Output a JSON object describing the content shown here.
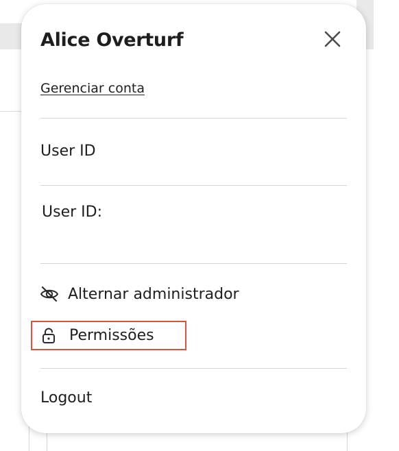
{
  "popup": {
    "user_name": "Alice Overturf",
    "close_icon": "close-icon",
    "manage_account_label": "Gerenciar conta",
    "user_id_label": "User ID",
    "user_id_field_label": "User ID:",
    "menu": {
      "toggle_admin": {
        "label": "Alternar administrador",
        "icon": "eye-off-icon"
      },
      "permissions": {
        "label": "Permissões",
        "icon": "lock-icon",
        "highlight_color": "#d9533f"
      }
    },
    "logout_label": "Logout"
  }
}
